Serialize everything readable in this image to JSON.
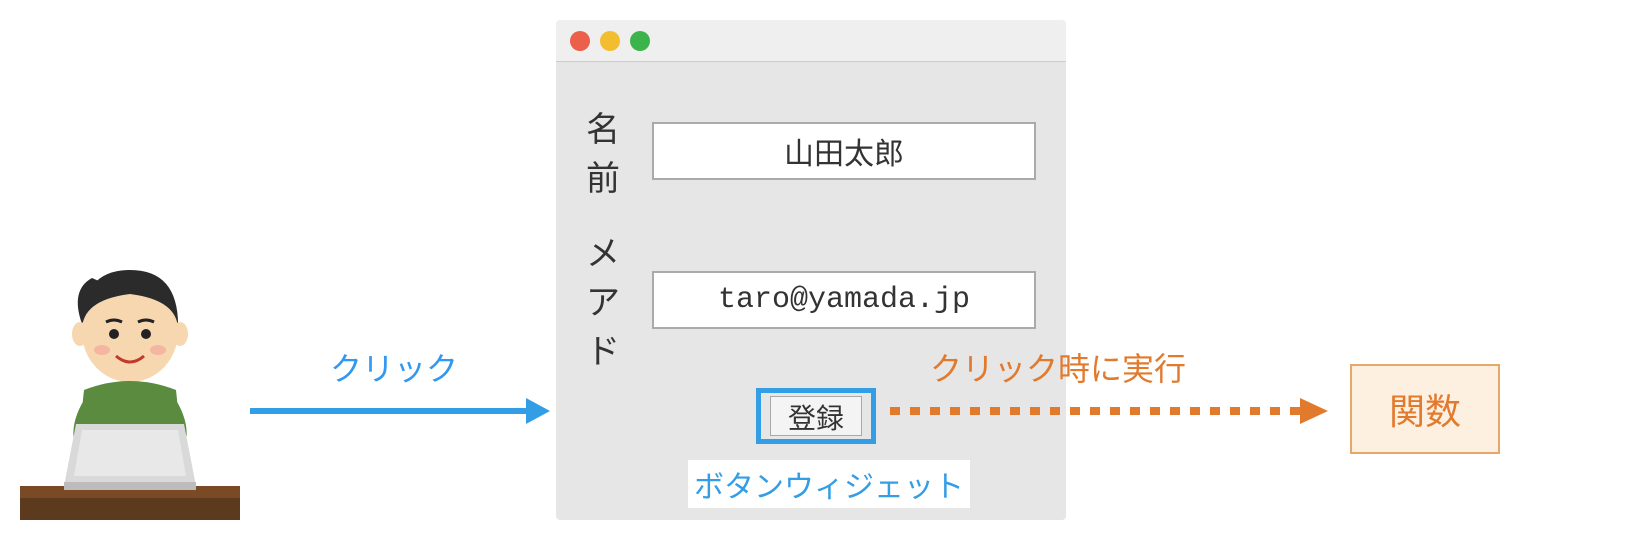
{
  "labels": {
    "click": "クリック",
    "execute_on_click": "クリック時に実行",
    "button_widget": "ボタンウィジェット",
    "function": "関数"
  },
  "form": {
    "name_label": "名前",
    "name_value": "山田太郎",
    "email_label": "メアド",
    "email_value": "taro@yamada.jp"
  },
  "button": {
    "register_label": "登録"
  },
  "colors": {
    "arrow_blue": "#339de6",
    "arrow_orange": "#e27a2e",
    "function_bg": "#fef0e1",
    "function_border": "#e6a86a"
  }
}
